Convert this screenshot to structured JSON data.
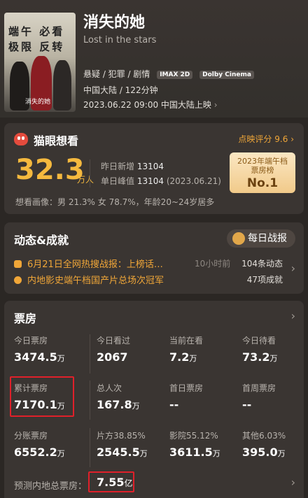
{
  "movie": {
    "title": "消失的她",
    "subtitle": "Lost in the stars",
    "genres": "悬疑 / 犯罪 / 剧情",
    "badges": [
      "IMAX 2D",
      "Dolby Cinema"
    ],
    "region_duration": "中国大陆 / 122分钟",
    "release": "2023.06.22 09:00 中国大陆上映",
    "poster_lines": [
      "端午 必看",
      "极限 反转"
    ],
    "poster_title": "消失的她"
  },
  "maoyan": {
    "title": "猫眼想看",
    "score_label": "点映评分",
    "score": "9.6",
    "want_count": "32.3",
    "want_unit": "万人",
    "yesterday_label": "昨日新增",
    "yesterday_value": "13104",
    "peak_label": "单日峰值",
    "peak_value": "13104",
    "peak_date": "(2023.06.21)",
    "rank_title": "2023年端午档",
    "rank_subtitle": "票房榜",
    "rank_value": "No.1",
    "portrait": "想看画像：男 21.3%   女 78.7%，年龄20~24岁居多"
  },
  "dynamics": {
    "title": "动态&成就",
    "daily_report": "每日战报",
    "news": [
      {
        "text": "6月21日全网热搜战报：上榜话…",
        "time": "10小时前",
        "count": "104条动态"
      },
      {
        "text": "内地影史端午档国产片总场次冠军",
        "time": "",
        "count": "47项成就"
      }
    ]
  },
  "box_office": {
    "title": "票房",
    "cells": [
      {
        "label": "今日票房",
        "value": "3474.5",
        "unit": "万"
      },
      {
        "label": "今日看过",
        "value": "2067",
        "unit": ""
      },
      {
        "label": "当前在看",
        "value": "7.2",
        "unit": "万"
      },
      {
        "label": "今日待看",
        "value": "73.2",
        "unit": "万"
      },
      {
        "label": "累计票房",
        "value": "7170.1",
        "unit": "万"
      },
      {
        "label": "总人次",
        "value": "167.8",
        "unit": "万"
      },
      {
        "label": "首日票房",
        "value": "--",
        "unit": ""
      },
      {
        "label": "首周票房",
        "value": "--",
        "unit": ""
      },
      {
        "label": "分账票房",
        "value": "6552.2",
        "unit": "万"
      },
      {
        "label": "片方38.85%",
        "value": "2545.5",
        "unit": "万"
      },
      {
        "label": "影院55.12%",
        "value": "3611.5",
        "unit": "万"
      },
      {
        "label": "其他6.03%",
        "value": "395.0",
        "unit": "万"
      }
    ],
    "predict_label": "预测内地总票房：",
    "predict_value": "7.55",
    "predict_unit": "亿"
  },
  "colors": {
    "accent": "#f5b93e",
    "highlight": "#e0202a",
    "background": "#2b2724"
  }
}
